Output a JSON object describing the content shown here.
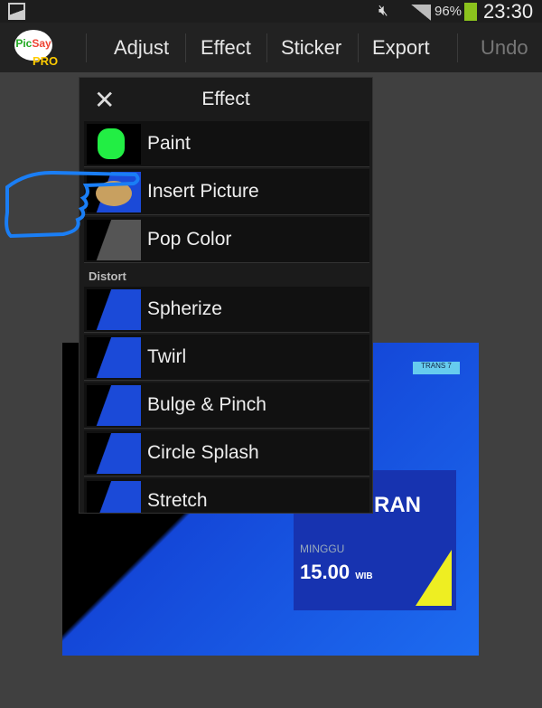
{
  "status": {
    "battery": "96%",
    "time": "23:30",
    "battery_color": "#8bc21d"
  },
  "app": {
    "logo_a": "Pic",
    "logo_b": "Say",
    "logo_pro": "PRO"
  },
  "toolbar": {
    "items": [
      "Adjust",
      "Effect",
      "Sticker",
      "Export"
    ],
    "undo": "Undo"
  },
  "photo": {
    "title": "PINGGIRAN",
    "day": "MINGGU",
    "time": "15.00",
    "tz": "WIB",
    "badge": "TRANS 7"
  },
  "popup": {
    "title": "Effect",
    "items": [
      "Paint",
      "Insert Picture",
      "Pop Color"
    ],
    "section": "Distort",
    "distort_items": [
      "Spherize",
      "Twirl",
      "Bulge & Pinch",
      "Circle Splash",
      "Stretch"
    ]
  }
}
